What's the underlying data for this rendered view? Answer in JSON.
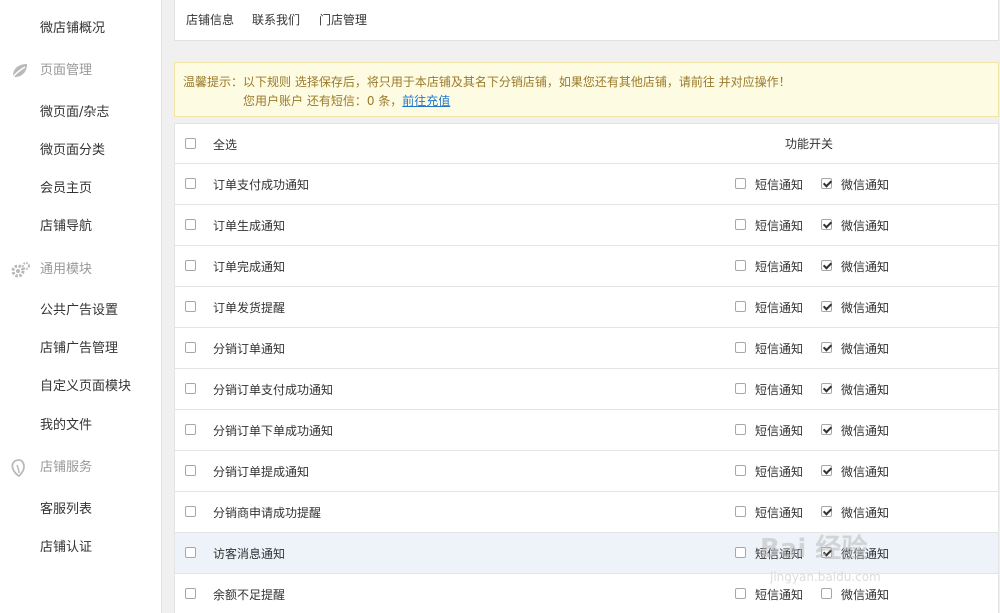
{
  "sidebar": {
    "top_item": "微店铺概况",
    "groups": [
      {
        "icon": "leaf-icon",
        "label": "页面管理",
        "items": [
          "微页面/杂志",
          "微页面分类",
          "会员主页",
          "店铺导航"
        ]
      },
      {
        "icon": "gear-icon",
        "label": "通用模块",
        "items": [
          "公共广告设置",
          "店铺广告管理",
          "自定义页面模块",
          "我的文件"
        ]
      },
      {
        "icon": "service-icon",
        "label": "店铺服务",
        "items": [
          "客服列表",
          "店铺认证"
        ]
      }
    ]
  },
  "tabs": [
    "店铺信息",
    "联系我们",
    "门店管理"
  ],
  "notice": {
    "line1": "温馨提示：以下规则 选择保存后，将只用于本店铺及其名下分销店铺，如果您还有其他店铺，请前往 并对应操作！",
    "line2_prefix": "您用户账户 还有短信：0 条，",
    "line2_link": "前往充值"
  },
  "table": {
    "select_all": "全选",
    "function_switch": "功能开关",
    "sms_label": "短信通知",
    "wechat_label": "微信通知",
    "rows": [
      {
        "label": "订单支付成功通知",
        "sms": false,
        "wechat": true
      },
      {
        "label": "订单生成通知",
        "sms": false,
        "wechat": true
      },
      {
        "label": "订单完成通知",
        "sms": false,
        "wechat": true
      },
      {
        "label": "订单发货提醒",
        "sms": false,
        "wechat": true
      },
      {
        "label": "分销订单通知",
        "sms": false,
        "wechat": true
      },
      {
        "label": "分销订单支付成功通知",
        "sms": false,
        "wechat": true
      },
      {
        "label": "分销订单下单成功通知",
        "sms": false,
        "wechat": true
      },
      {
        "label": "分销订单提成通知",
        "sms": false,
        "wechat": true
      },
      {
        "label": "分销商申请成功提醒",
        "sms": false,
        "wechat": true
      },
      {
        "label": "访客消息通知",
        "sms": false,
        "wechat": true
      },
      {
        "label": "余额不足提醒",
        "sms": false,
        "wechat": false
      }
    ]
  },
  "watermark": {
    "main": "Bai 经验",
    "sub": "jingyan.baidu.com"
  }
}
